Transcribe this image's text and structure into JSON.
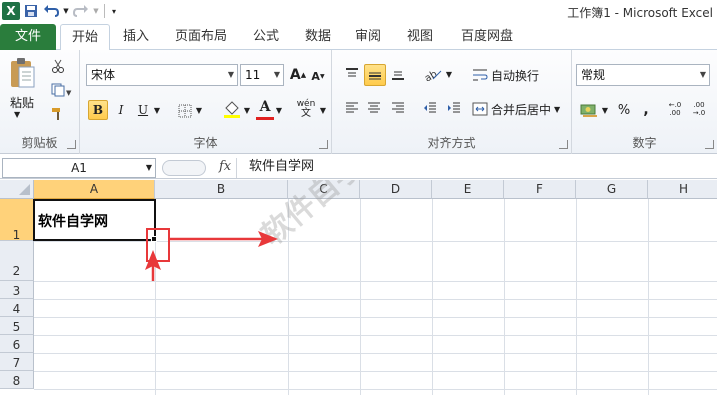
{
  "window": {
    "title": "工作簿1 - Microsoft Excel"
  },
  "qat": {
    "app_icon": "X"
  },
  "tabs": [
    {
      "label": "文件"
    },
    {
      "label": "开始"
    },
    {
      "label": "插入"
    },
    {
      "label": "页面布局"
    },
    {
      "label": "公式"
    },
    {
      "label": "数据"
    },
    {
      "label": "审阅"
    },
    {
      "label": "视图"
    },
    {
      "label": "百度网盘"
    }
  ],
  "clipboard": {
    "paste_label": "粘贴",
    "group_label": "剪贴板"
  },
  "font": {
    "name": "宋体",
    "size": "11",
    "bold": "B",
    "italic": "I",
    "underline": "U",
    "font_color_glyph": "A",
    "wen_glyph": "wén",
    "group_label": "字体"
  },
  "alignment": {
    "wrap_label": "自动换行",
    "merge_label": "合并后居中",
    "group_label": "对齐方式"
  },
  "number": {
    "format": "常规",
    "percent": "%",
    "comma": ",",
    "group_label": "数字"
  },
  "formula_bar": {
    "name_box": "A1",
    "fx": "fx",
    "content": "软件自学网"
  },
  "sheet": {
    "columns": [
      "A",
      "B",
      "C",
      "D",
      "E",
      "F",
      "G",
      "H"
    ],
    "rows": [
      "1",
      "2",
      "3",
      "4",
      "5",
      "6",
      "7",
      "8"
    ],
    "selected_column": "A",
    "selected_row": "1",
    "active_cell_value": "软件自学网"
  },
  "watermark": "软件自学网 WWW.RJZXW.COM",
  "colors": {
    "accent": "#2a7d3c",
    "selection": "#ffd27a",
    "arrow": "#e8383a"
  }
}
